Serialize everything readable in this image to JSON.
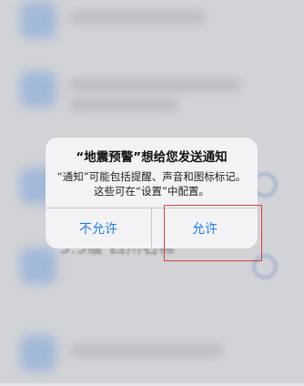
{
  "background_list": {
    "visible_item_text": "5.5级 四川石棉"
  },
  "alert": {
    "title": "“地震预警”想给您发送通知",
    "message": "“通知”可能包括提醒、声音和图标标记。这些可在“设置”中配置。",
    "deny_label": "不允许",
    "allow_label": "允许"
  },
  "colors": {
    "accent": "#1F7CF2",
    "highlight_border": "#D8433D",
    "alert_background": "#F3F3F5"
  }
}
